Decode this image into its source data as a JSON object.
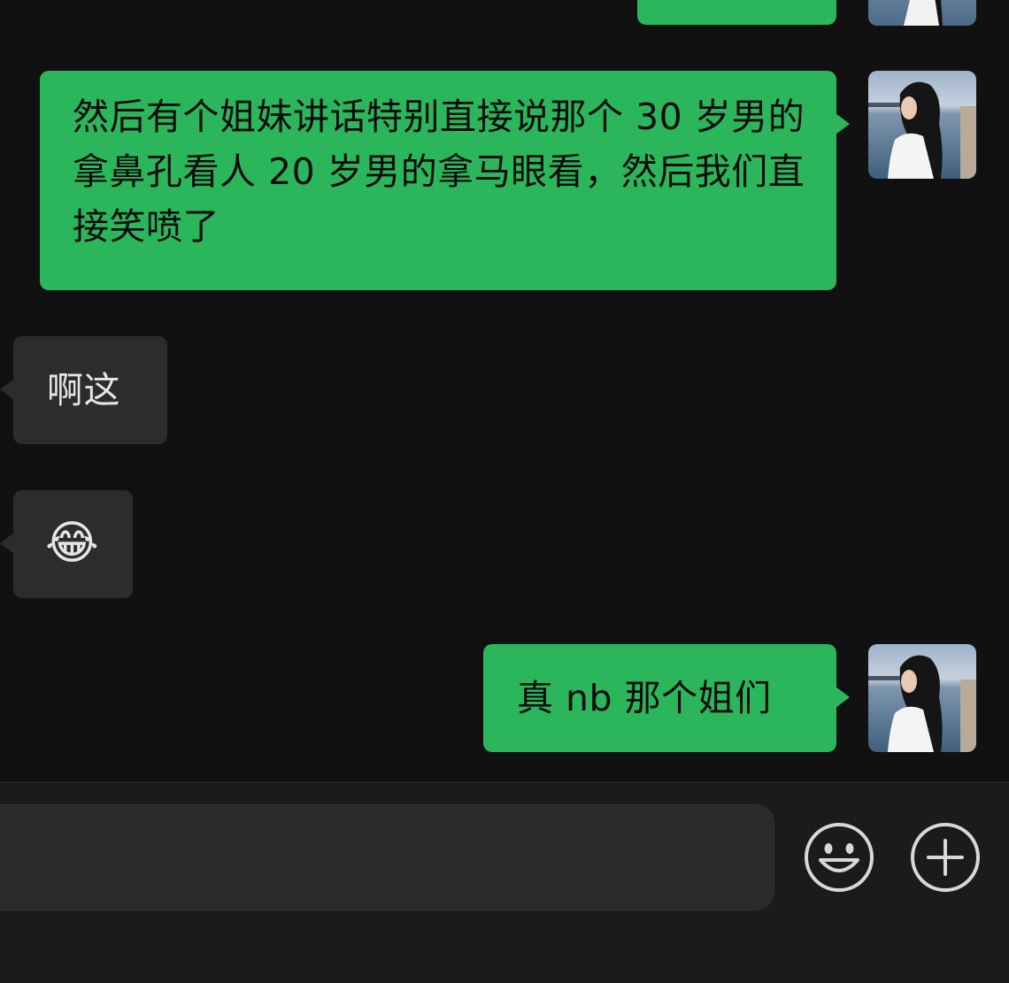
{
  "messages": [
    {
      "id": "m0",
      "side": "out",
      "text": ""
    },
    {
      "id": "m1",
      "side": "out",
      "text": "然后有个姐妹讲话特别直接说那个 30 岁男的拿鼻孔看人 20 岁男的拿马眼看，然后我们直接笑喷了"
    },
    {
      "id": "m2",
      "side": "in",
      "text": "啊这"
    },
    {
      "id": "m3",
      "side": "in",
      "text": "😂"
    },
    {
      "id": "m4",
      "side": "out",
      "text": "真 nb 那个姐们"
    }
  ],
  "input": {
    "value": "",
    "emoji_icon": "smiley-face-icon",
    "plus_icon": "plus-circle-icon"
  },
  "colors": {
    "background": "#111111",
    "outgoing_bubble": "#2bb65c",
    "incoming_bubble": "#2c2c2c",
    "input_bar": "#1b1b1b"
  }
}
